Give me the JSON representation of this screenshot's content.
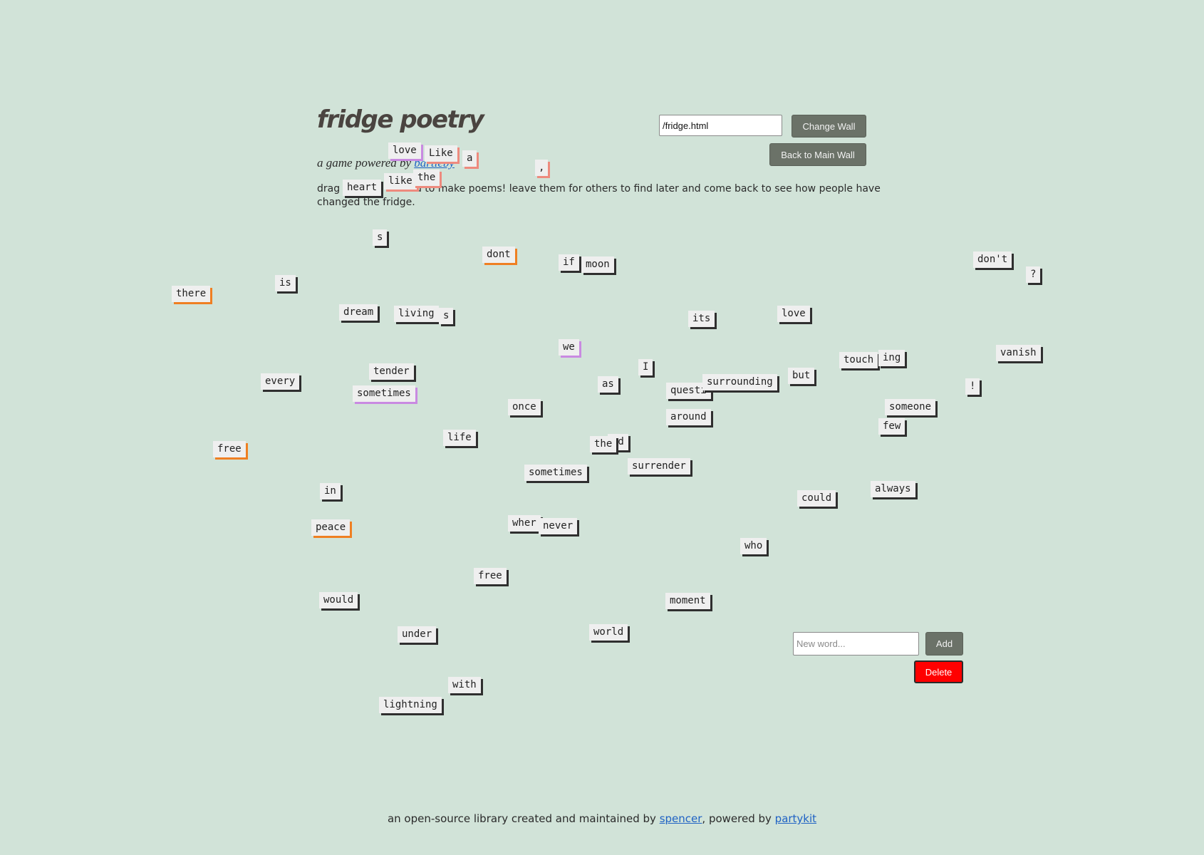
{
  "header": {
    "title": "fridge poetry",
    "subtitle_prefix": "a game powered by ",
    "subtitle_link": "bartleby",
    "description": "drag the tiles around to make poems! leave them for others to find later and come back to see how people have changed the fridge."
  },
  "wall": {
    "path_value": "/fridge.html",
    "change_label": "Change Wall",
    "back_label": "Back to Main Wall"
  },
  "word_form": {
    "placeholder": "New word...",
    "add_label": "Add",
    "delete_label": "Delete"
  },
  "footer": {
    "prefix": "an open-source library created and maintained by ",
    "author_link": "spencer",
    "mid": ", powered by ",
    "platform_link": "partykit"
  },
  "colors": {
    "background": "#d1e3d8",
    "tile": "#efefef",
    "shadow_default": "#2f2f2f",
    "shadow_orange": "#ef7f22",
    "shadow_pink": "#ee8a7e",
    "shadow_purple": "#c98ae1",
    "delete": "#ff0000"
  },
  "tiles": [
    "love",
    "Like",
    "a",
    ",",
    "heart",
    "like",
    "the",
    "s",
    "dont",
    "if",
    "moon",
    "don't",
    "?",
    "is",
    "there",
    "dream",
    "living",
    "s",
    "its",
    "love",
    "we",
    "vanish",
    "touch",
    "ing",
    "tender",
    "every",
    "sometimes",
    "I",
    "as",
    "surrounding",
    "questi",
    "but",
    "!",
    "someone",
    "once",
    "around",
    "few",
    "free",
    "life",
    "the",
    "nd",
    "surrender",
    "sometimes",
    "in",
    "always",
    "could",
    "peace",
    "wher",
    "never",
    "who",
    "free",
    "would",
    "moment",
    "under",
    "world",
    "with",
    "lightning"
  ]
}
